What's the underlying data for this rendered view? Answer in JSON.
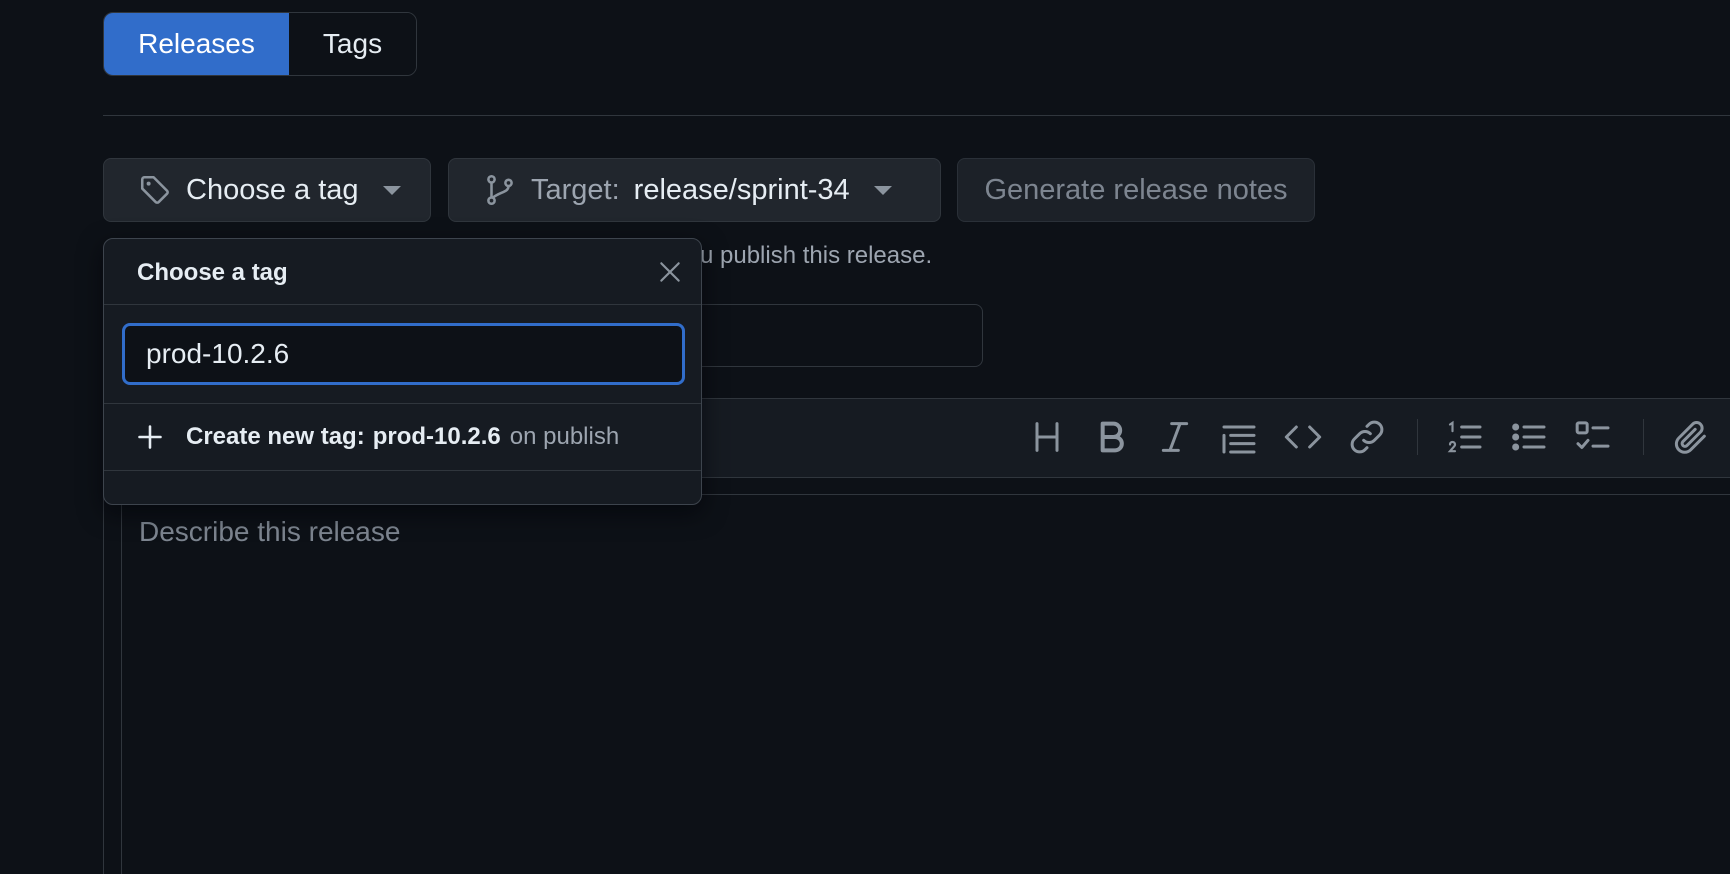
{
  "tabs": {
    "releases_label": "Releases",
    "tags_label": "Tags",
    "active": "Releases"
  },
  "actions": {
    "choose_tag_label": "Choose a tag",
    "target_prefix": "Target:",
    "target_value": "release/sprint-34",
    "generate_notes_label": "Generate release notes"
  },
  "helper_text": "u publish this release.",
  "tag_popover": {
    "title": "Choose a tag",
    "search_value": "prod-10.2.6",
    "create_lead": "Create new tag:",
    "create_tag_name": "prod-10.2.6",
    "create_suffix": "on publish"
  },
  "editor": {
    "placeholder": "Describe this release",
    "toolbar_icons": [
      "heading-icon",
      "bold-icon",
      "italic-icon",
      "quote-icon",
      "code-icon",
      "link-icon",
      "ordered-list-icon",
      "unordered-list-icon",
      "task-list-icon",
      "attach-icon"
    ]
  },
  "colors": {
    "background": "#0d1117",
    "accent": "#316dca",
    "border": "#30363d",
    "muted_text": "#7d8590"
  }
}
